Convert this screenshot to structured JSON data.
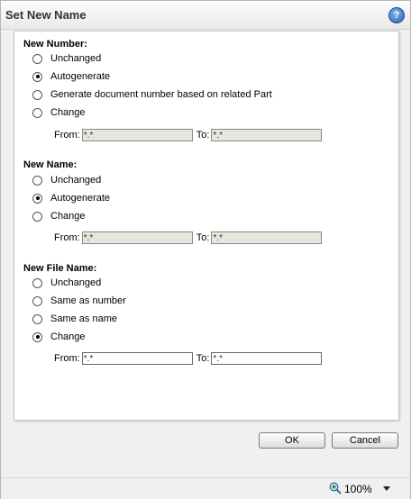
{
  "window": {
    "title": "Set New Name",
    "help_icon": "?"
  },
  "new_number": {
    "label": "New Number:",
    "options": [
      {
        "label": "Unchanged",
        "checked": false
      },
      {
        "label": "Autogenerate",
        "checked": true
      },
      {
        "label": "Generate document number based on related Part",
        "checked": false
      },
      {
        "label": "Change",
        "checked": false
      }
    ],
    "from_label": "From:",
    "from_value": "*.*",
    "to_label": "To:",
    "to_value": "*.*"
  },
  "new_name": {
    "label": "New Name:",
    "options": [
      {
        "label": "Unchanged",
        "checked": false
      },
      {
        "label": "Autogenerate",
        "checked": true
      },
      {
        "label": "Change",
        "checked": false
      }
    ],
    "from_label": "From:",
    "from_value": "*.*",
    "to_label": "To:",
    "to_value": "*.*"
  },
  "new_file_name": {
    "label": "New File Name:",
    "options": [
      {
        "label": "Unchanged",
        "checked": false
      },
      {
        "label": "Same as number",
        "checked": false
      },
      {
        "label": "Same as name",
        "checked": false
      },
      {
        "label": "Change",
        "checked": true
      }
    ],
    "from_label": "From:",
    "from_value": "*.*",
    "to_label": "To:",
    "to_value": "*.*"
  },
  "buttons": {
    "ok": "OK",
    "cancel": "Cancel"
  },
  "status": {
    "zoom": "100%",
    "zoom_icon": "zoom-in-icon"
  }
}
